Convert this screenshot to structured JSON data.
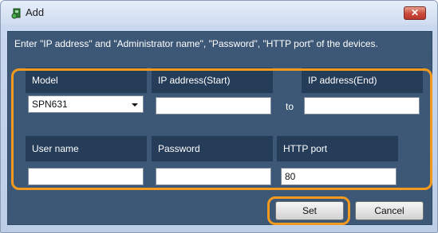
{
  "window": {
    "title": "Add",
    "close_symbol": "✕"
  },
  "instructions": "Enter \"IP address\" and \"Administrator name\", \"Password\", \"HTTP port\" of the devices.",
  "form": {
    "model_label": "Model",
    "model_value": "SPN631",
    "ip_start_label": "IP address(Start)",
    "ip_start_value": "",
    "to_label": "to",
    "ip_end_label": "IP address(End)",
    "ip_end_value": "",
    "username_label": "User name",
    "username_value": "",
    "password_label": "Password",
    "password_value": "",
    "http_port_label": "HTTP port",
    "http_port_value": "80"
  },
  "buttons": {
    "set": "Set",
    "cancel": "Cancel"
  },
  "highlight_color": "#f39a1e"
}
